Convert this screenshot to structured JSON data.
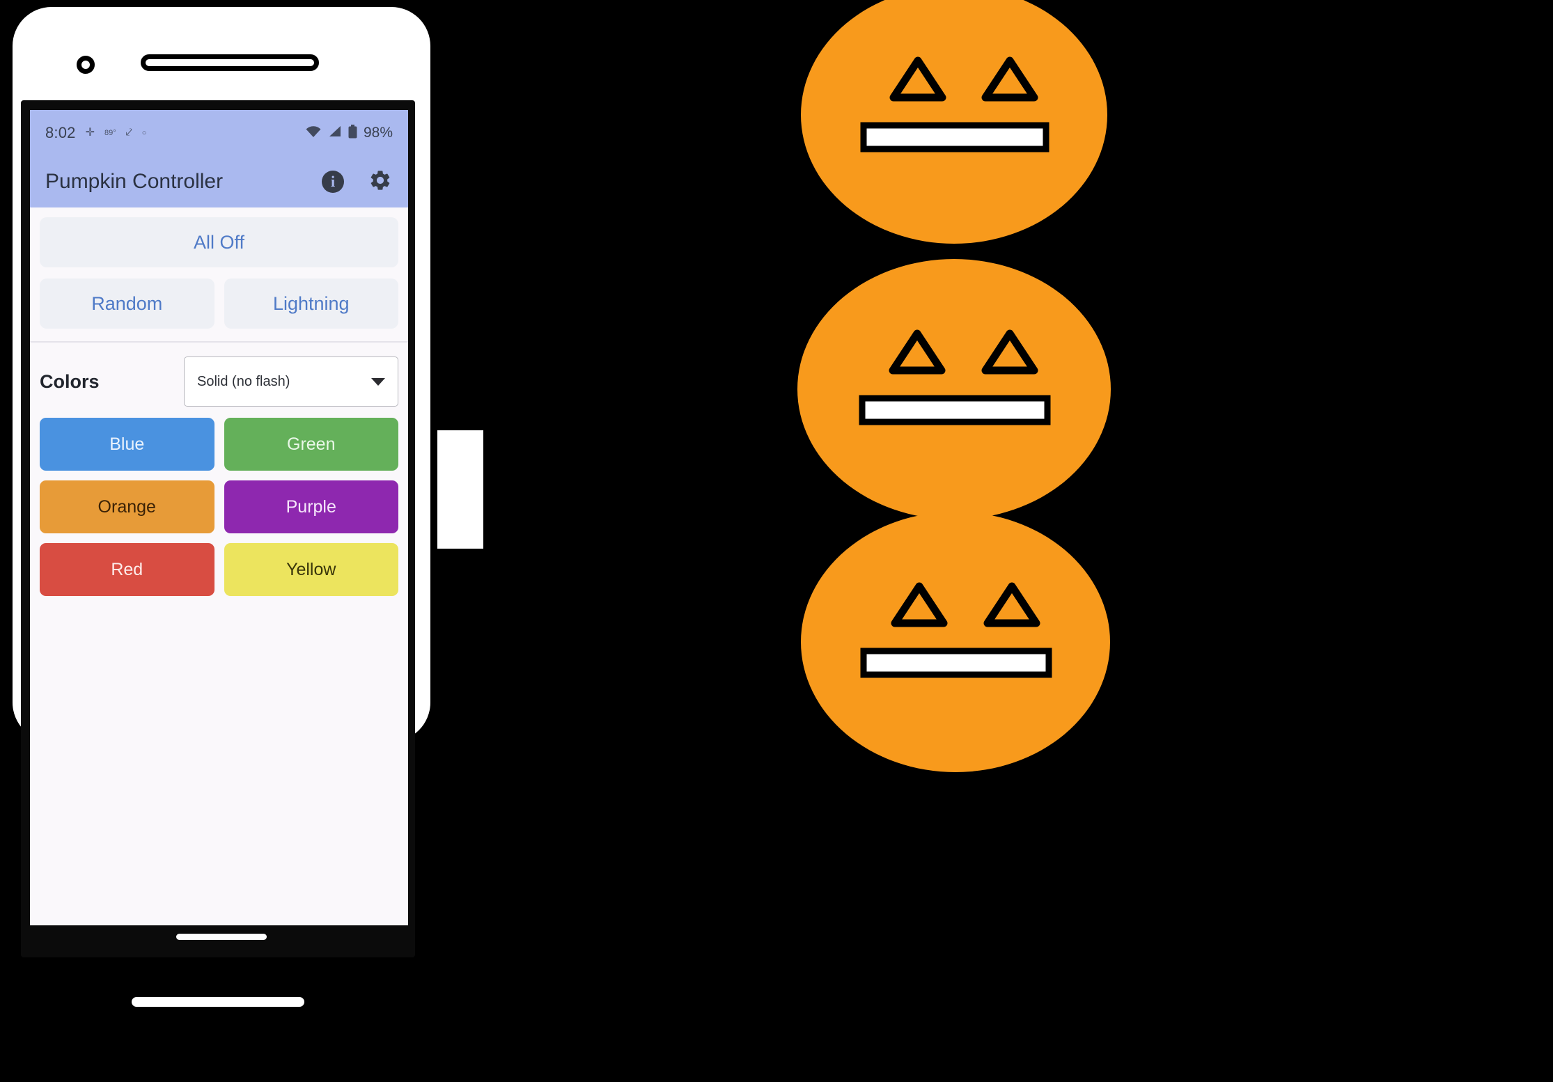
{
  "app": {
    "title": "Pumpkin Controller",
    "statusbar": {
      "time": "8:02",
      "icons": [
        "location-icon",
        "weather-icon",
        "bluetooth-icon",
        "dot-icon"
      ],
      "wifi": "wifi-icon",
      "signal": "signal-icon",
      "battery_icon": "battery-icon",
      "battery": "98%"
    },
    "actions": {
      "info_label": "i",
      "info_name": "info-icon",
      "settings_name": "gear-icon"
    },
    "buttons": {
      "all_off": "All Off",
      "random": "Random",
      "lightning": "Lightning"
    },
    "colors_section": {
      "label": "Colors",
      "mode_selected": "Solid (no flash)",
      "mode_options": [
        "Solid (no flash)"
      ],
      "swatches": [
        {
          "label": "Blue",
          "bg": "#4a92e0",
          "fg": "#eaf3fd"
        },
        {
          "label": "Green",
          "bg": "#64b05a",
          "fg": "#e9f7e7"
        },
        {
          "label": "Orange",
          "bg": "#e79b38",
          "fg": "#3b2206"
        },
        {
          "label": "Purple",
          "bg": "#8e28af",
          "fg": "#f6e7fb"
        },
        {
          "label": "Red",
          "bg": "#d84d42",
          "fg": "#fdecea"
        },
        {
          "label": "Yellow",
          "bg": "#ece45e",
          "fg": "#3a360a"
        }
      ]
    },
    "accent_color": "#4f7ac7",
    "appbar_color": "#aab9ef",
    "screen_bg": "#faf8fb"
  },
  "pumpkins": [
    {
      "name": "pumpkin-top",
      "color": "#F89A1C",
      "face": "neutral"
    },
    {
      "name": "pumpkin-middle",
      "color": "#F89A1C",
      "face": "neutral"
    },
    {
      "name": "pumpkin-bottom",
      "color": "#F89A1C",
      "face": "neutral"
    }
  ]
}
